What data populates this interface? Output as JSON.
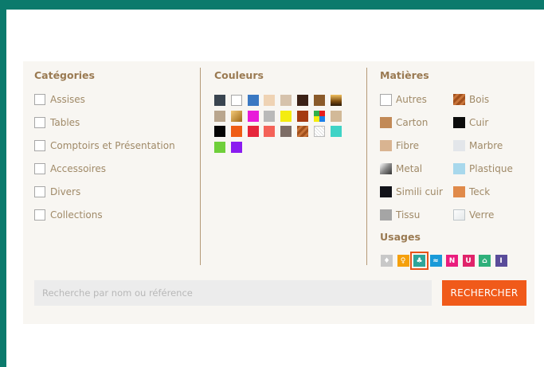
{
  "filters": {
    "categories": {
      "title": "Catégories",
      "items": [
        "Assises",
        "Tables",
        "Comptoirs et Présentation",
        "Accessoires",
        "Divers",
        "Collections"
      ]
    },
    "colors": {
      "title": "Couleurs",
      "swatches": [
        "#3a4550",
        "#ffffff",
        "#3a78c2",
        "#efd3b4",
        "#d6c2ac",
        "#3b2116",
        "#8a5a2a",
        "gradient-gold",
        "#b9a68e",
        "gradient-bronze",
        "#e81bd9",
        "#b9b9b9",
        "#f4ec10",
        "#a53a12",
        "multicolor",
        "#d2b998",
        "#050505",
        "#ef5d14",
        "#e6263b",
        "#f46258",
        "#7d6d66",
        "wood",
        "pattern",
        "#3fd3c6",
        "#6fcf3a",
        "#8a1cf0"
      ]
    },
    "materials": {
      "title": "Matières",
      "items": [
        {
          "label": "Autres",
          "swatch": "checkbox"
        },
        {
          "label": "Bois",
          "swatch": "wood"
        },
        {
          "label": "Carton",
          "swatch": "#c28a57"
        },
        {
          "label": "Cuir",
          "swatch": "#0c0c0c"
        },
        {
          "label": "Fibre",
          "swatch": "#d9b491"
        },
        {
          "label": "Marbre",
          "swatch": "#e3e6ea"
        },
        {
          "label": "Metal",
          "swatch": "metal"
        },
        {
          "label": "Plastique",
          "swatch": "#a8d8ec"
        },
        {
          "label": "Simili cuir",
          "swatch": "#12131a"
        },
        {
          "label": "Teck",
          "swatch": "#e08a4a"
        },
        {
          "label": "Tissu",
          "swatch": "#a5a5a5"
        },
        {
          "label": "Verre",
          "swatch": "glass"
        }
      ]
    },
    "usages": {
      "title": "Usages",
      "icons": [
        {
          "name": "torch-icon",
          "color": "#c8c8c8",
          "glyph": "♦"
        },
        {
          "name": "bulb-icon",
          "color": "#f5a00c",
          "glyph": "♀"
        },
        {
          "name": "tree-icon",
          "color": "#2da59a",
          "glyph": "♣",
          "selected": true
        },
        {
          "name": "wave-icon",
          "color": "#1a9ad8",
          "glyph": "≈"
        },
        {
          "name": "new-icon",
          "color": "#ea1d7e",
          "glyph": "N"
        },
        {
          "name": "magnet-icon",
          "color": "#e0246a",
          "glyph": "U"
        },
        {
          "name": "outdoor-icon",
          "color": "#2fb07a",
          "glyph": "⌂"
        },
        {
          "name": "info-icon",
          "color": "#5a4c9a",
          "glyph": "I"
        }
      ]
    }
  },
  "search": {
    "placeholder": "Recherche par nom ou référence",
    "button_label": "RECHERCHER"
  }
}
